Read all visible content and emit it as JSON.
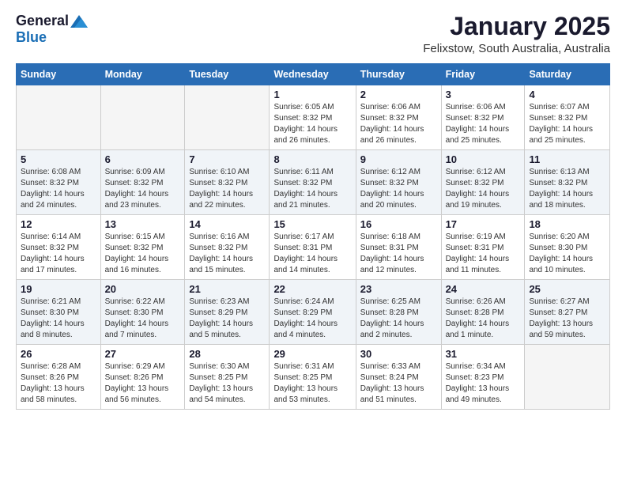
{
  "logo": {
    "general": "General",
    "blue": "Blue"
  },
  "title": "January 2025",
  "subtitle": "Felixstow, South Australia, Australia",
  "days_header": [
    "Sunday",
    "Monday",
    "Tuesday",
    "Wednesday",
    "Thursday",
    "Friday",
    "Saturday"
  ],
  "weeks": [
    {
      "shade": false,
      "days": [
        {
          "num": "",
          "info": "",
          "empty": true
        },
        {
          "num": "",
          "info": "",
          "empty": true
        },
        {
          "num": "",
          "info": "",
          "empty": true
        },
        {
          "num": "1",
          "info": "Sunrise: 6:05 AM\nSunset: 8:32 PM\nDaylight: 14 hours\nand 26 minutes.",
          "empty": false
        },
        {
          "num": "2",
          "info": "Sunrise: 6:06 AM\nSunset: 8:32 PM\nDaylight: 14 hours\nand 26 minutes.",
          "empty": false
        },
        {
          "num": "3",
          "info": "Sunrise: 6:06 AM\nSunset: 8:32 PM\nDaylight: 14 hours\nand 25 minutes.",
          "empty": false
        },
        {
          "num": "4",
          "info": "Sunrise: 6:07 AM\nSunset: 8:32 PM\nDaylight: 14 hours\nand 25 minutes.",
          "empty": false
        }
      ]
    },
    {
      "shade": true,
      "days": [
        {
          "num": "5",
          "info": "Sunrise: 6:08 AM\nSunset: 8:32 PM\nDaylight: 14 hours\nand 24 minutes.",
          "empty": false
        },
        {
          "num": "6",
          "info": "Sunrise: 6:09 AM\nSunset: 8:32 PM\nDaylight: 14 hours\nand 23 minutes.",
          "empty": false
        },
        {
          "num": "7",
          "info": "Sunrise: 6:10 AM\nSunset: 8:32 PM\nDaylight: 14 hours\nand 22 minutes.",
          "empty": false
        },
        {
          "num": "8",
          "info": "Sunrise: 6:11 AM\nSunset: 8:32 PM\nDaylight: 14 hours\nand 21 minutes.",
          "empty": false
        },
        {
          "num": "9",
          "info": "Sunrise: 6:12 AM\nSunset: 8:32 PM\nDaylight: 14 hours\nand 20 minutes.",
          "empty": false
        },
        {
          "num": "10",
          "info": "Sunrise: 6:12 AM\nSunset: 8:32 PM\nDaylight: 14 hours\nand 19 minutes.",
          "empty": false
        },
        {
          "num": "11",
          "info": "Sunrise: 6:13 AM\nSunset: 8:32 PM\nDaylight: 14 hours\nand 18 minutes.",
          "empty": false
        }
      ]
    },
    {
      "shade": false,
      "days": [
        {
          "num": "12",
          "info": "Sunrise: 6:14 AM\nSunset: 8:32 PM\nDaylight: 14 hours\nand 17 minutes.",
          "empty": false
        },
        {
          "num": "13",
          "info": "Sunrise: 6:15 AM\nSunset: 8:32 PM\nDaylight: 14 hours\nand 16 minutes.",
          "empty": false
        },
        {
          "num": "14",
          "info": "Sunrise: 6:16 AM\nSunset: 8:32 PM\nDaylight: 14 hours\nand 15 minutes.",
          "empty": false
        },
        {
          "num": "15",
          "info": "Sunrise: 6:17 AM\nSunset: 8:31 PM\nDaylight: 14 hours\nand 14 minutes.",
          "empty": false
        },
        {
          "num": "16",
          "info": "Sunrise: 6:18 AM\nSunset: 8:31 PM\nDaylight: 14 hours\nand 12 minutes.",
          "empty": false
        },
        {
          "num": "17",
          "info": "Sunrise: 6:19 AM\nSunset: 8:31 PM\nDaylight: 14 hours\nand 11 minutes.",
          "empty": false
        },
        {
          "num": "18",
          "info": "Sunrise: 6:20 AM\nSunset: 8:30 PM\nDaylight: 14 hours\nand 10 minutes.",
          "empty": false
        }
      ]
    },
    {
      "shade": true,
      "days": [
        {
          "num": "19",
          "info": "Sunrise: 6:21 AM\nSunset: 8:30 PM\nDaylight: 14 hours\nand 8 minutes.",
          "empty": false
        },
        {
          "num": "20",
          "info": "Sunrise: 6:22 AM\nSunset: 8:30 PM\nDaylight: 14 hours\nand 7 minutes.",
          "empty": false
        },
        {
          "num": "21",
          "info": "Sunrise: 6:23 AM\nSunset: 8:29 PM\nDaylight: 14 hours\nand 5 minutes.",
          "empty": false
        },
        {
          "num": "22",
          "info": "Sunrise: 6:24 AM\nSunset: 8:29 PM\nDaylight: 14 hours\nand 4 minutes.",
          "empty": false
        },
        {
          "num": "23",
          "info": "Sunrise: 6:25 AM\nSunset: 8:28 PM\nDaylight: 14 hours\nand 2 minutes.",
          "empty": false
        },
        {
          "num": "24",
          "info": "Sunrise: 6:26 AM\nSunset: 8:28 PM\nDaylight: 14 hours\nand 1 minute.",
          "empty": false
        },
        {
          "num": "25",
          "info": "Sunrise: 6:27 AM\nSunset: 8:27 PM\nDaylight: 13 hours\nand 59 minutes.",
          "empty": false
        }
      ]
    },
    {
      "shade": false,
      "days": [
        {
          "num": "26",
          "info": "Sunrise: 6:28 AM\nSunset: 8:26 PM\nDaylight: 13 hours\nand 58 minutes.",
          "empty": false
        },
        {
          "num": "27",
          "info": "Sunrise: 6:29 AM\nSunset: 8:26 PM\nDaylight: 13 hours\nand 56 minutes.",
          "empty": false
        },
        {
          "num": "28",
          "info": "Sunrise: 6:30 AM\nSunset: 8:25 PM\nDaylight: 13 hours\nand 54 minutes.",
          "empty": false
        },
        {
          "num": "29",
          "info": "Sunrise: 6:31 AM\nSunset: 8:25 PM\nDaylight: 13 hours\nand 53 minutes.",
          "empty": false
        },
        {
          "num": "30",
          "info": "Sunrise: 6:33 AM\nSunset: 8:24 PM\nDaylight: 13 hours\nand 51 minutes.",
          "empty": false
        },
        {
          "num": "31",
          "info": "Sunrise: 6:34 AM\nSunset: 8:23 PM\nDaylight: 13 hours\nand 49 minutes.",
          "empty": false
        },
        {
          "num": "",
          "info": "",
          "empty": true
        }
      ]
    }
  ]
}
